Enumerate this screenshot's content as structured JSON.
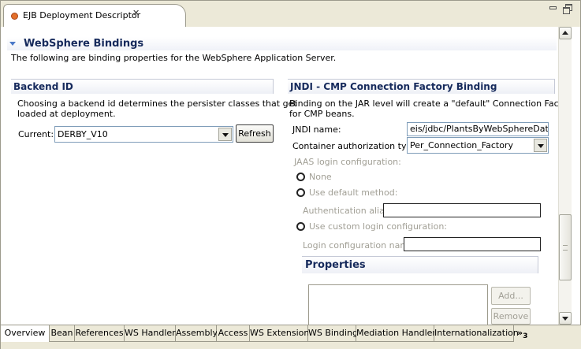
{
  "editor": {
    "tab_title": "EJB Deployment Descriptor",
    "close_glyph": "✕"
  },
  "section": {
    "title": "WebSphere Bindings",
    "description": "The following are binding properties for the WebSphere Application Server."
  },
  "backend": {
    "title": "Backend ID",
    "desc_line1": "Choosing a backend id determines the persister classes that get",
    "desc_line2": "loaded at deployment.",
    "current_label": "Current:",
    "current_value": "DERBY_V10",
    "refresh_label": "Refresh"
  },
  "jndi": {
    "title": "JNDI - CMP Connection Factory Binding",
    "desc_line1": "Binding on the JAR level will create a \"default\" Connection Factory",
    "desc_line2": "for CMP beans.",
    "name_label": "JNDI name:",
    "name_value": "eis/jdbc/PlantsByWebSphereDataSo",
    "auth_type_label": "Container authorization type:",
    "auth_type_value": "Per_Connection_Factory",
    "jaas_label": "JAAS login configuration:",
    "radio_none": "None",
    "radio_default": "Use default method:",
    "auth_alias_label": "Authentication alias:",
    "auth_alias_value": "",
    "radio_custom": "Use custom login configuration:",
    "login_config_label": "Login configuration name:",
    "login_config_value": "",
    "properties_title": "Properties",
    "add_label": "Add...",
    "remove_label": "Remove"
  },
  "page_tabs": [
    "Overview",
    "Bean",
    "References",
    "WS Handler",
    "Assembly",
    "Access",
    "WS Extension",
    "WS Binding",
    "Mediation Handlers",
    "Internationalization"
  ],
  "more_tabs": {
    "chevron": "»",
    "count": "3"
  }
}
